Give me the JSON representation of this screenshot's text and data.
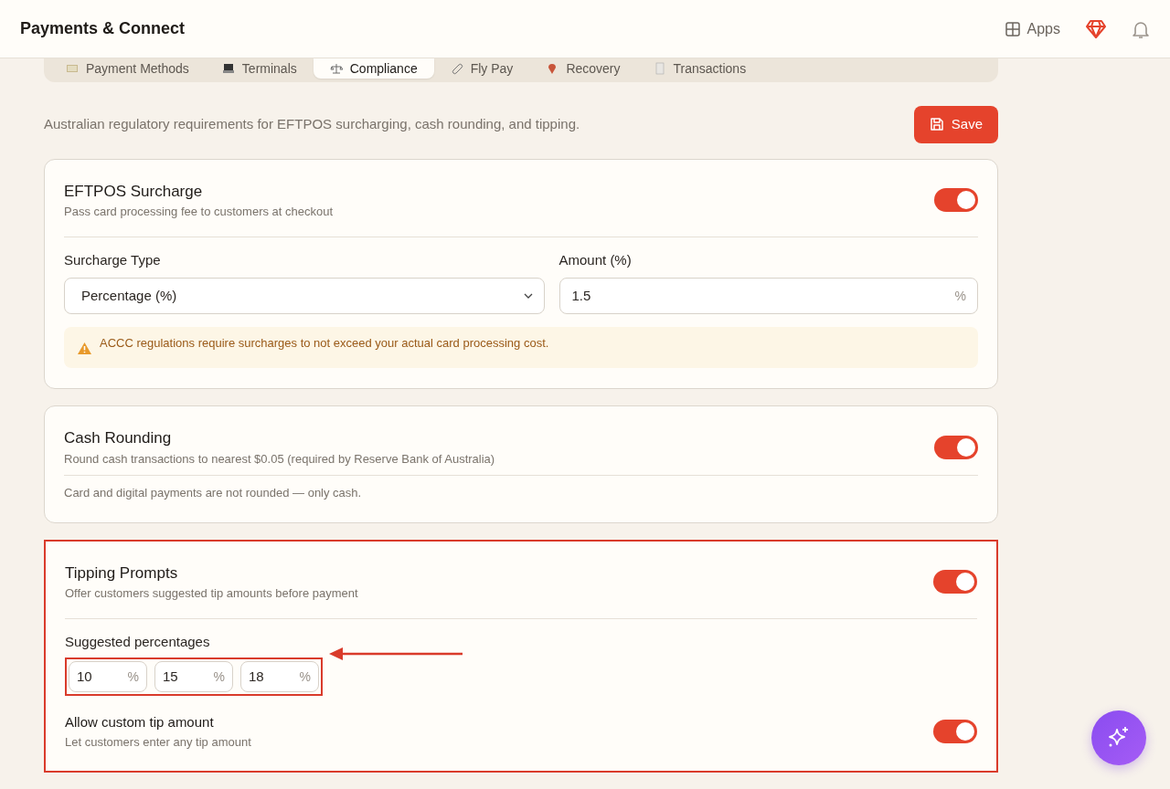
{
  "header": {
    "title": "Payments & Connect",
    "apps_label": "Apps"
  },
  "tabs": [
    {
      "label": "Payment Methods",
      "selected": false
    },
    {
      "label": "Terminals",
      "selected": false
    },
    {
      "label": "Compliance",
      "selected": true
    },
    {
      "label": "Fly Pay",
      "selected": false
    },
    {
      "label": "Recovery",
      "selected": false
    },
    {
      "label": "Transactions",
      "selected": false
    }
  ],
  "intro": "Australian regulatory requirements for EFTPOS surcharging, cash rounding, and tipping.",
  "save_button": "Save",
  "cards": [
    {
      "title": "EFTPOS Surcharge",
      "subtitle": "Pass card processing fee to customers at checkout",
      "on": true,
      "highlighted": false,
      "body": [
        {
          "kind": "fields",
          "fields": [
            {
              "label": "Surcharge Type",
              "kind": "select",
              "value": "Percentage (%)"
            },
            {
              "label": "Amount (%)",
              "kind": "input",
              "value": "1.5",
              "suffix": "%"
            }
          ]
        },
        {
          "kind": "alert",
          "text": "ACCC regulations require surcharges to not exceed your actual card processing cost."
        }
      ]
    },
    {
      "title": "Cash Rounding",
      "subtitle": "Round cash transactions to nearest $0.05 (required by Reserve Bank of Australia)",
      "on": true,
      "highlighted": false,
      "body": [
        {
          "kind": "note",
          "text": "Card and digital payments are not rounded — only cash."
        }
      ]
    },
    {
      "title": "Tipping Prompts",
      "subtitle": "Offer customers suggested tip amounts before payment",
      "on": true,
      "highlighted": true,
      "body": [
        {
          "kind": "percentages",
          "label": "Suggested percentages",
          "highlighted": true,
          "values": [
            {
              "value": "10",
              "suffix": "%"
            },
            {
              "value": "15",
              "suffix": "%"
            },
            {
              "value": "18",
              "suffix": "%"
            }
          ]
        },
        {
          "kind": "toggle",
          "title": "Allow custom tip amount",
          "subtitle": "Let customers enter any tip amount",
          "on": true
        }
      ]
    }
  ]
}
